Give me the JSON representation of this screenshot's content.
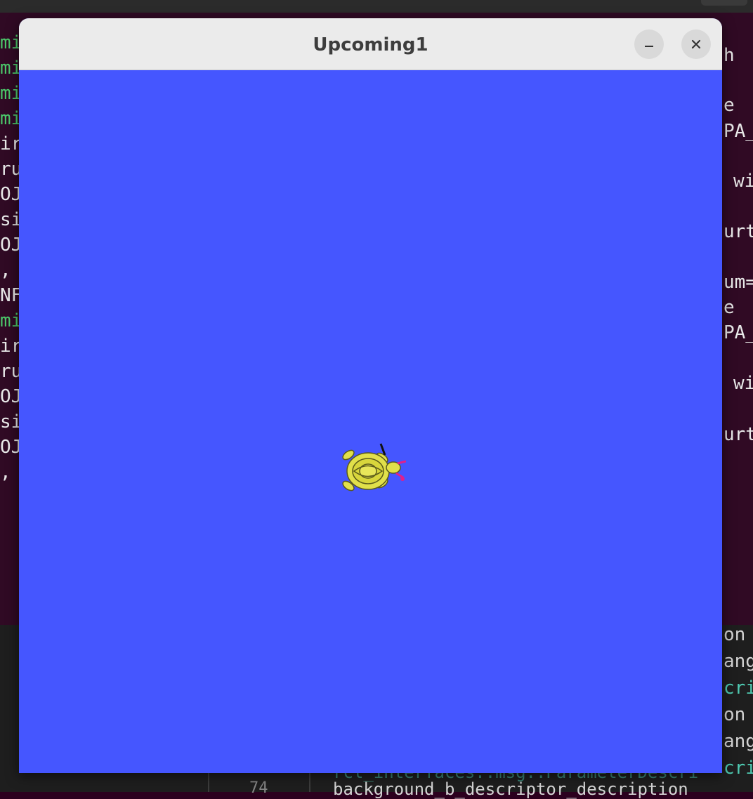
{
  "window": {
    "title": "Upcoming1",
    "minimize_label": "–",
    "close_label": "×",
    "background_color": "#4556ff"
  },
  "canvas": {
    "turtle_icon": "turtle-icon",
    "turtle_color": "#e1e04a"
  },
  "background_terminal": {
    "left_fragments": [
      "mi",
      "mi",
      "mi",
      "mi",
      "ir",
      "ru",
      "OJ",
      "si",
      "OJ",
      ",",
      "NF",
      "mi",
      "ir",
      "ru",
      "OJ",
      "si",
      "OJ",
      ","
    ],
    "right_fragments": [
      "h",
      "e",
      "PA_",
      "wi",
      "urt",
      "um=",
      "e",
      "PA_",
      "wi",
      "urt"
    ]
  },
  "background_editor": {
    "right_fragments": [
      "on",
      "ang",
      "cri",
      "on",
      "ang",
      "cri"
    ],
    "line_number": "74",
    "bottom_code": "background_b_descriptor_description",
    "ghost_code": "rcl_interfaces::msg::ParameterDescri"
  }
}
